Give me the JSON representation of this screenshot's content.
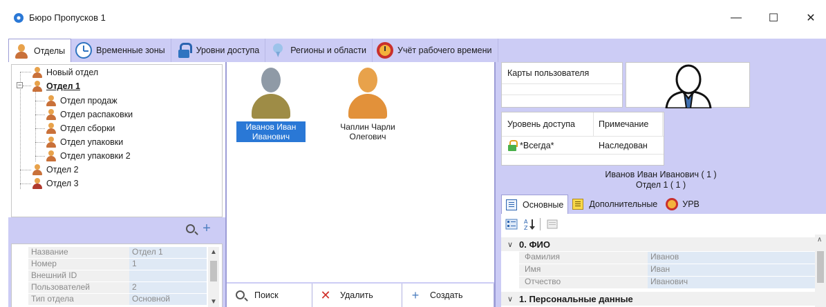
{
  "window": {
    "title": "Бюро Пропусков 1",
    "minimize": "—",
    "maximize": "☐",
    "close": "✕"
  },
  "tabs": [
    {
      "label": "Отделы",
      "icon": "person-icon",
      "active": true
    },
    {
      "label": "Временные зоны",
      "icon": "clock-icon"
    },
    {
      "label": "Уровни доступа",
      "icon": "lock-icon"
    },
    {
      "label": "Регионы и области",
      "icon": "pin-icon"
    },
    {
      "label": "Учёт рабочего времени",
      "icon": "time-tracking-icon"
    }
  ],
  "tree": {
    "nodes": [
      {
        "label": "Новый отдел"
      },
      {
        "label": "Отдел 1"
      },
      {
        "label": "Отдел продаж"
      },
      {
        "label": "Отдел распаковки"
      },
      {
        "label": "Отдел сборки"
      },
      {
        "label": "Отдел упаковки"
      },
      {
        "label": "Отдел упаковки 2"
      },
      {
        "label": "Отдел 2"
      },
      {
        "label": "Отдел 3"
      }
    ],
    "expand_symbol": "−"
  },
  "department_props": [
    {
      "key": "Название",
      "value": "Отдел 1"
    },
    {
      "key": "Номер",
      "value": "1"
    },
    {
      "key": "Внешний ID",
      "value": ""
    },
    {
      "key": "Пользователей",
      "value": "2"
    },
    {
      "key": "Тип отдела",
      "value": "Основной"
    }
  ],
  "users": [
    {
      "name": "Иванов Иван Иванович",
      "selected": true
    },
    {
      "name": "Чаплин Чарли Олегович",
      "selected": false
    }
  ],
  "user_actions": {
    "search": "Поиск",
    "delete": "Удалить",
    "create": "Создать"
  },
  "cards": {
    "header": "Карты пользователя"
  },
  "access": {
    "col_level": "Уровень доступа",
    "col_note": "Примечание",
    "rows": [
      {
        "level": "*Всегда*",
        "note": "Наследован"
      }
    ]
  },
  "user_info": {
    "name_line": "Иванов Иван Иванович ( 1 )",
    "dept_line": "Отдел 1 ( 1 )"
  },
  "sub_tabs": {
    "main": "Основные",
    "extra": "Дополнительные",
    "urv": "УРВ"
  },
  "property_grid": {
    "sections": [
      {
        "title": "0. ФИО"
      },
      {
        "title": "1. Персональные данные"
      }
    ],
    "rows": [
      {
        "key": "Фамилия",
        "value": "Иванов"
      },
      {
        "key": "Имя",
        "value": "Иван"
      },
      {
        "key": "Отчество",
        "value": "Иванович"
      }
    ]
  },
  "colors": {
    "accent_panel": "#ccccf5",
    "selection": "#2a78d6"
  }
}
